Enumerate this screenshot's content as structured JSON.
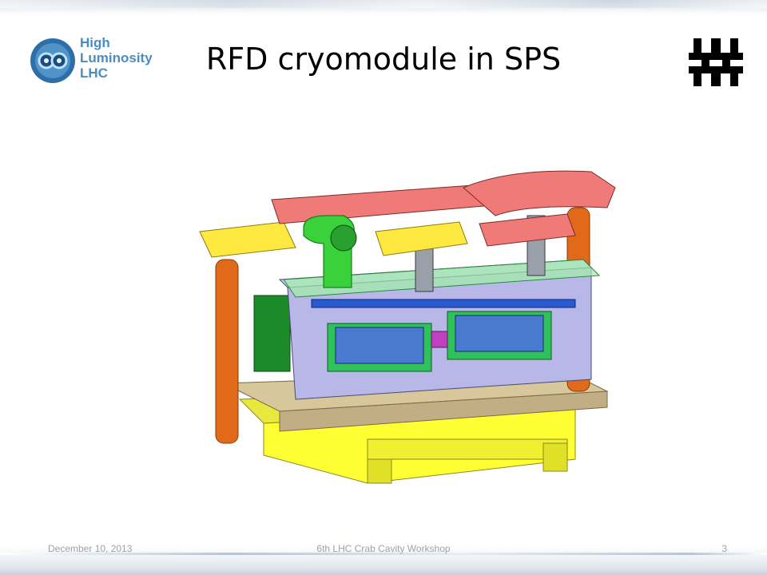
{
  "slide": {
    "title": "RFD cryomodule in SPS",
    "logo_left": {
      "line1": "High",
      "line2": "Luminosity",
      "line3": "LHC",
      "icon": "high-luminosity-lhc-logo"
    },
    "logo_right": {
      "icon": "fermilab-logo"
    },
    "figure": {
      "icon": "cryomodule-cad-drawing"
    },
    "footer": {
      "date": "December 10, 2013",
      "event": "6th LHC Crab Cavity Workshop",
      "page": "3"
    }
  },
  "colors": {
    "title": "#000000",
    "footer_text": "#9aa3ad",
    "hl_blue": "#4a8cc4"
  }
}
